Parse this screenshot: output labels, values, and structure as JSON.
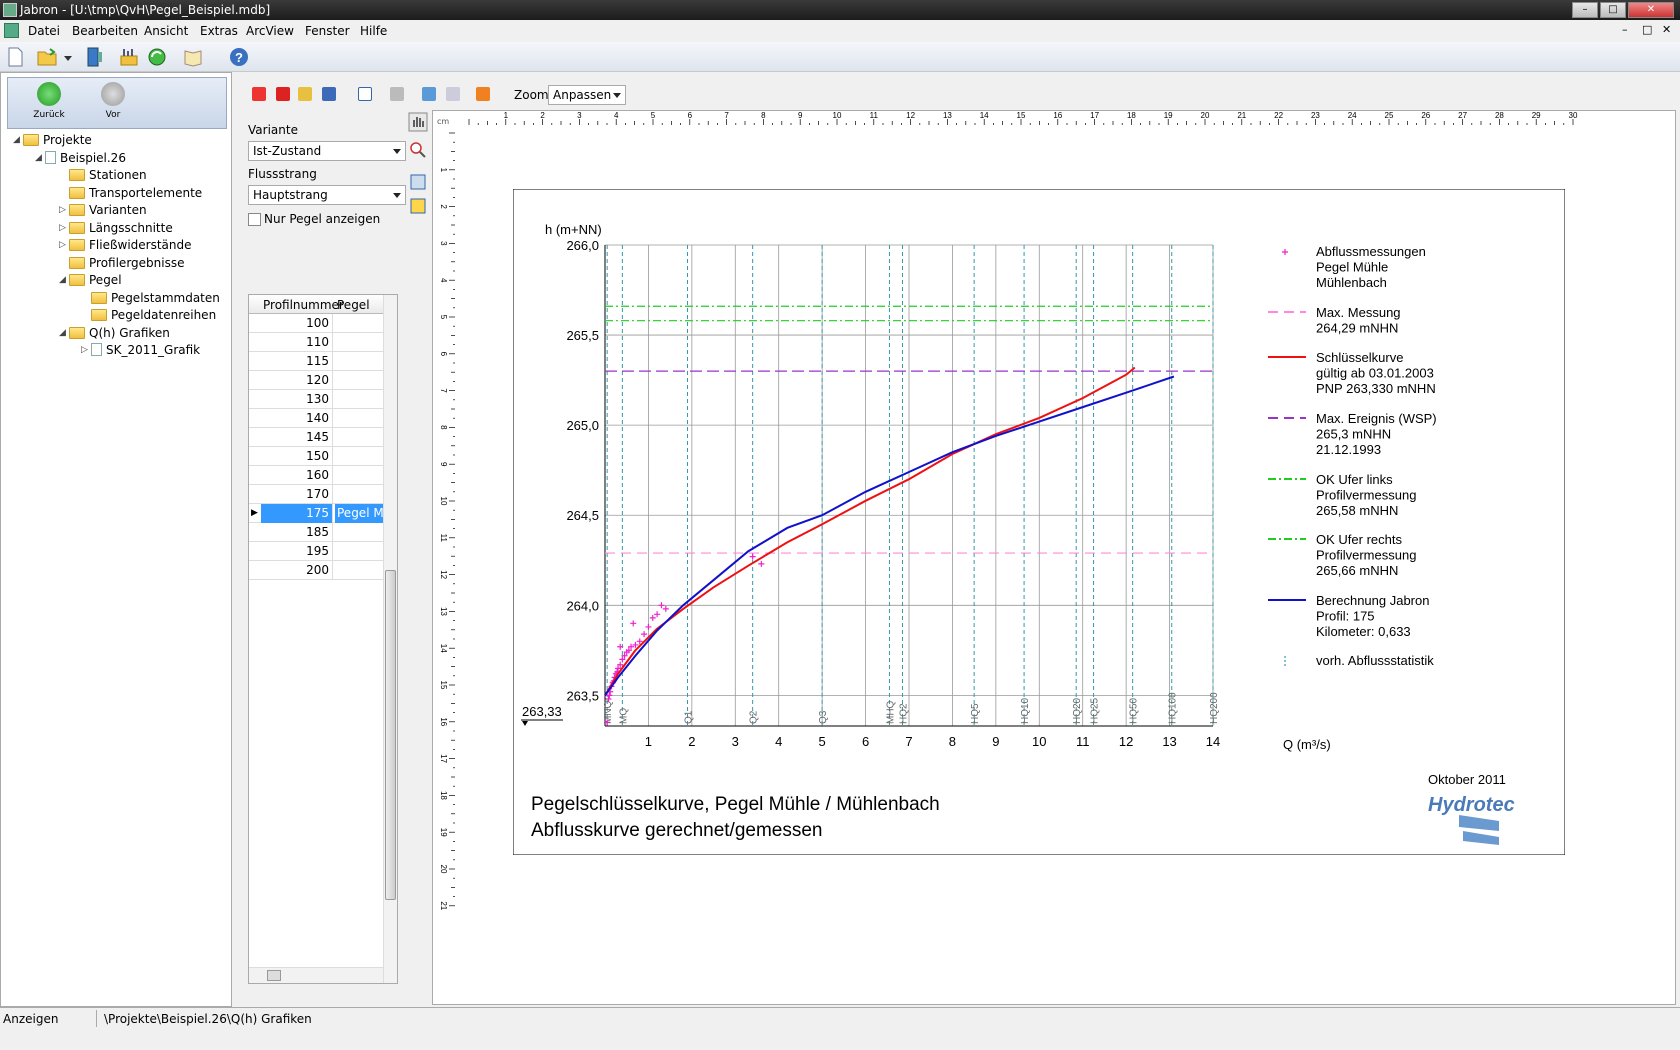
{
  "window": {
    "title": "Jabron - [U:\\tmp\\QvH\\Pegel_Beispiel.mdb]",
    "controls": [
      "–",
      "□",
      "✕"
    ]
  },
  "menu": [
    "Datei",
    "Bearbeiten",
    "Ansicht",
    "Extras",
    "ArcView",
    "Fenster",
    "Hilfe"
  ],
  "mdi_controls": [
    "–",
    "□",
    "✕"
  ],
  "nav": {
    "back": "Zurück",
    "forward": "Vor"
  },
  "tree": [
    {
      "label": "Projekte",
      "level": 0,
      "kind": "folder",
      "exp": "◢"
    },
    {
      "label": "Beispiel.26",
      "level": 1,
      "kind": "doc",
      "exp": "◢"
    },
    {
      "label": "Stationen",
      "level": 2,
      "kind": "folder",
      "exp": ""
    },
    {
      "label": "Transportelemente",
      "level": 2,
      "kind": "folder",
      "exp": ""
    },
    {
      "label": "Varianten",
      "level": 2,
      "kind": "folder",
      "exp": "▷"
    },
    {
      "label": "Längsschnitte",
      "level": 2,
      "kind": "folder",
      "exp": "▷"
    },
    {
      "label": "Fließwiderstände",
      "level": 2,
      "kind": "folder",
      "exp": "▷"
    },
    {
      "label": "Profilergebnisse",
      "level": 2,
      "kind": "folder",
      "exp": ""
    },
    {
      "label": "Pegel",
      "level": 2,
      "kind": "folder",
      "exp": "◢"
    },
    {
      "label": "Pegelstammdaten",
      "level": 3,
      "kind": "folder",
      "exp": ""
    },
    {
      "label": "Pegeldatenreihen",
      "level": 3,
      "kind": "folder",
      "exp": ""
    },
    {
      "label": "Q(h) Grafiken",
      "level": 2,
      "kind": "folder",
      "exp": "◢"
    },
    {
      "label": "SK_2011_Grafik",
      "level": 3,
      "kind": "doc",
      "exp": "▷"
    }
  ],
  "toolbar2": {
    "zoom_label": "Zoom",
    "zoom_value": "Anpassen"
  },
  "form": {
    "variante_label": "Variante",
    "variante_value": "Ist-Zustand",
    "flussstrang_label": "Flussstrang",
    "flussstrang_value": "Hauptstrang",
    "nur_pegel_label": "Nur Pegel anzeigen",
    "nur_pegel_checked": false
  },
  "grid": {
    "headers": [
      "Profilnummer",
      "Pegel"
    ],
    "rows": [
      {
        "nr": "100",
        "pegel": ""
      },
      {
        "nr": "110",
        "pegel": ""
      },
      {
        "nr": "115",
        "pegel": ""
      },
      {
        "nr": "120",
        "pegel": ""
      },
      {
        "nr": "130",
        "pegel": ""
      },
      {
        "nr": "140",
        "pegel": ""
      },
      {
        "nr": "145",
        "pegel": ""
      },
      {
        "nr": "150",
        "pegel": ""
      },
      {
        "nr": "160",
        "pegel": ""
      },
      {
        "nr": "170",
        "pegel": ""
      },
      {
        "nr": "175",
        "pegel": "Pegel Mü",
        "selected": true
      },
      {
        "nr": "185",
        "pegel": ""
      },
      {
        "nr": "195",
        "pegel": ""
      },
      {
        "nr": "200",
        "pegel": ""
      }
    ]
  },
  "ruler": {
    "unit": "cm",
    "h_max": 30,
    "v_max": 21
  },
  "chart_data": {
    "type": "line",
    "ylabel": "h (m+NN)",
    "xlabel": "Q (m³/s)",
    "xlim": [
      0,
      14
    ],
    "ylim": [
      263.33,
      266.0
    ],
    "x_ticks": [
      1,
      2,
      3,
      4,
      5,
      6,
      7,
      8,
      9,
      10,
      11,
      12,
      13,
      14
    ],
    "y_ticks": [
      "263,5",
      "264,0",
      "264,5",
      "265,0",
      "265,5",
      "266,0"
    ],
    "pnp_label": "263,33",
    "title_line1": "Pegelschlüsselkurve, Pegel Mühle / Mühlenbach",
    "title_line2": "Abflusskurve gerechnet/gemessen",
    "date": "Oktober 2011",
    "logo": "Hydrotec",
    "stat_lines": [
      {
        "label": "MNQ",
        "x": 0.05
      },
      {
        "label": "MQ",
        "x": 0.4
      },
      {
        "label": "Q1",
        "x": 1.9
      },
      {
        "label": "Q2",
        "x": 3.4
      },
      {
        "label": "Q3",
        "x": 5.0
      },
      {
        "label": "MHQ",
        "x": 6.55
      },
      {
        "label": "HQ2",
        "x": 6.85
      },
      {
        "label": "HQ5",
        "x": 8.5
      },
      {
        "label": "HQ10",
        "x": 9.65
      },
      {
        "label": "HQ20",
        "x": 10.85
      },
      {
        "label": "HQ25",
        "x": 11.25
      },
      {
        "label": "HQ50",
        "x": 12.15
      },
      {
        "label": "HQ100",
        "x": 13.05
      },
      {
        "label": "HQ200",
        "x": 14.0
      }
    ],
    "hlines": [
      {
        "name": "Max. Messung",
        "y": 264.29,
        "color": "#ff88dd",
        "dash": "10,6"
      },
      {
        "name": "Max. Ereignis (WSP)",
        "y": 265.3,
        "color": "#9933cc",
        "dash": "12,5"
      },
      {
        "name": "OK Ufer links",
        "y": 265.58,
        "color": "#22cc22",
        "dash": "8,3,2,3"
      },
      {
        "name": "OK Ufer rechts",
        "y": 265.66,
        "color": "#22cc22",
        "dash": "8,3,2,3"
      }
    ],
    "series": [
      {
        "name": "Schlüsselkurve",
        "color": "#ee1111",
        "x": [
          0,
          0.3,
          0.7,
          1.2,
          1.8,
          2.5,
          3.3,
          4.2,
          5.0,
          6.0,
          7.0,
          8.0,
          9.0,
          10.0,
          11.0,
          12.0,
          12.2
        ],
        "y": [
          263.5,
          263.62,
          263.75,
          263.87,
          263.98,
          264.1,
          264.22,
          264.35,
          264.45,
          264.58,
          264.7,
          264.84,
          264.95,
          265.04,
          265.15,
          265.28,
          265.32
        ]
      },
      {
        "name": "Berechnung Jabron",
        "color": "#1111cc",
        "x": [
          0,
          0.3,
          0.7,
          1.2,
          1.8,
          2.5,
          3.3,
          4.2,
          5.0,
          6.0,
          7.0,
          8.0,
          9.0,
          10.0,
          11.0,
          12.0,
          13.1
        ],
        "y": [
          263.5,
          263.6,
          263.72,
          263.86,
          264.0,
          264.14,
          264.3,
          264.43,
          264.5,
          264.63,
          264.74,
          264.85,
          264.94,
          265.02,
          265.1,
          265.18,
          265.27
        ]
      }
    ],
    "measurements": {
      "name": "Abflussmessungen",
      "color": "#ee22cc",
      "x": [
        0.05,
        0.08,
        0.1,
        0.12,
        0.15,
        0.18,
        0.2,
        0.22,
        0.25,
        0.28,
        0.3,
        0.35,
        0.4,
        0.45,
        0.5,
        0.55,
        0.6,
        0.7,
        0.8,
        0.9,
        1.0,
        1.1,
        1.2,
        1.3,
        1.4,
        0.35,
        0.65,
        3.4,
        3.6
      ],
      "y": [
        263.35,
        263.48,
        263.5,
        263.52,
        263.55,
        263.57,
        263.58,
        263.6,
        263.62,
        263.63,
        263.65,
        263.67,
        263.7,
        263.72,
        263.74,
        263.75,
        263.77,
        263.78,
        263.8,
        263.84,
        263.88,
        263.93,
        263.95,
        264.0,
        263.98,
        263.77,
        263.9,
        264.27,
        264.23
      ]
    },
    "legend": [
      {
        "lines": [
          "Abflussmessungen",
          "Pegel Mühle",
          "Mühlenbach"
        ],
        "style": "plus",
        "color": "#ee22cc"
      },
      {
        "lines": [
          "Max. Messung",
          "264,29 mNHN"
        ],
        "style": "dash",
        "color": "#ff88dd"
      },
      {
        "lines": [
          "Schlüsselkurve",
          "gültig ab 03.01.2003",
          "PNP 263,330 mNHN"
        ],
        "style": "solid",
        "color": "#ee1111"
      },
      {
        "lines": [
          "Max. Ereignis (WSP)",
          "265,3 mNHN",
          "21.12.1993"
        ],
        "style": "dash",
        "color": "#9933cc"
      },
      {
        "lines": [
          "OK Ufer links",
          "Profilvermessung",
          "265,58 mNHN"
        ],
        "style": "dashdot",
        "color": "#22cc22"
      },
      {
        "lines": [
          "OK Ufer rechts",
          "Profilvermessung",
          "265,66 mNHN"
        ],
        "style": "dashdot",
        "color": "#22cc22"
      },
      {
        "lines": [
          "Berechnung Jabron",
          "Profil: 175",
          "Kilometer: 0,633"
        ],
        "style": "solid",
        "color": "#1111cc"
      },
      {
        "lines": [
          "vorh. Abflussstatistik"
        ],
        "style": "vdot",
        "color": "#3399aa"
      }
    ]
  },
  "status": {
    "left": "Anzeigen",
    "path": "\\Projekte\\Beispiel.26\\Q(h) Grafiken"
  }
}
